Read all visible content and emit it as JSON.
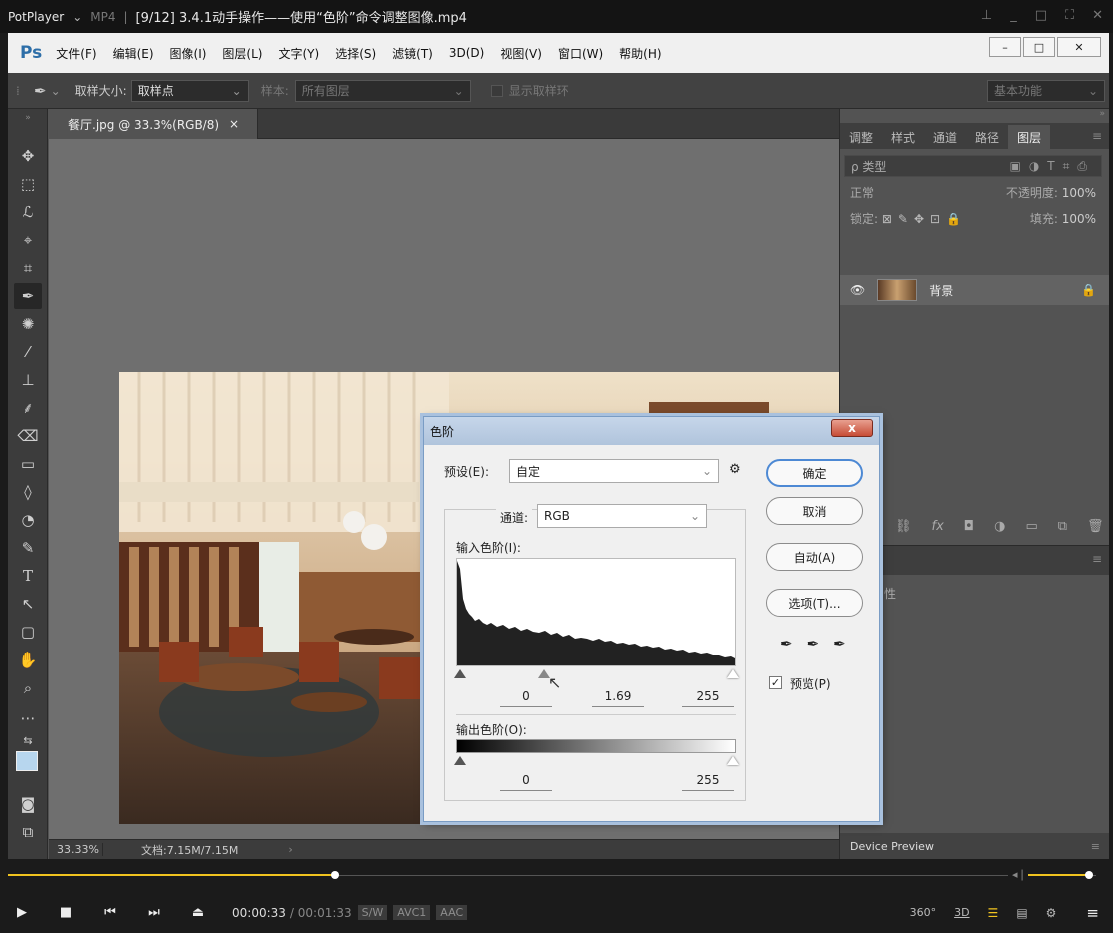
{
  "player": {
    "app_name": "PotPlayer",
    "format": "MP4",
    "file_title": "[9/12] 3.4.1动手操作——使用“色阶”命令调整图像.mp4",
    "time_current": "00:00:33",
    "time_total": "/ 00:01:33",
    "tags": [
      "S/W",
      "AVC1",
      "AAC"
    ],
    "right_controls": [
      "360°",
      "3D"
    ],
    "seek_progress": 0.327,
    "volume_level": 0.9
  },
  "ps": {
    "logo": "Ps",
    "menu": [
      "文件(F)",
      "编辑(E)",
      "图像(I)",
      "图层(L)",
      "文字(Y)",
      "选择(S)",
      "滤镜(T)",
      "3D(D)",
      "视图(V)",
      "窗口(W)",
      "帮助(H)"
    ],
    "options": {
      "sample_size_label": "取样大小:",
      "sample_size_value": "取样点",
      "sample_label": "样本:",
      "sample_value": "所有图层",
      "show_ring_label": "显示取样环",
      "workspace": "基本功能"
    },
    "doc_tab": "餐厅.jpg @ 33.3%(RGB/8)",
    "doc_tab_close": "×",
    "status": {
      "zoom": "33.33%",
      "doc_size": "文档:7.15M/7.15M"
    },
    "panels": {
      "tabs": [
        "调整",
        "样式",
        "通道",
        "路径",
        "图层"
      ],
      "active_tab": "图层",
      "kind_filter": "ρ 类型",
      "blend_mode": "正常",
      "opacity_label": "不透明度:",
      "opacity_value": "100%",
      "lock_label": "锁定:",
      "fill_label": "填充:",
      "fill_value": "100%",
      "layer_name": "背景",
      "partial_text": "性",
      "device_preview": "Device Preview"
    }
  },
  "levels": {
    "title": "色阶",
    "close": "x",
    "preset_label": "预设(E):",
    "preset_value": "自定",
    "channel_label": "通道:",
    "channel_value": "RGB",
    "input_label": "输入色阶(I):",
    "input_black": "0",
    "input_gamma": "1.69",
    "input_white": "255",
    "output_label": "输出色阶(O):",
    "output_black": "0",
    "output_white": "255",
    "buttons": {
      "ok": "确定",
      "cancel": "取消",
      "auto": "自动(A)",
      "options": "选项(T)..."
    },
    "preview_label": "预览(P)",
    "preview_checked": true
  },
  "colors": {
    "accent": "#f0c31f",
    "ps_blue": "#2d6ea8",
    "default_button_border": "#4d89d4",
    "foreground_swatch": "#b7d6ee"
  }
}
